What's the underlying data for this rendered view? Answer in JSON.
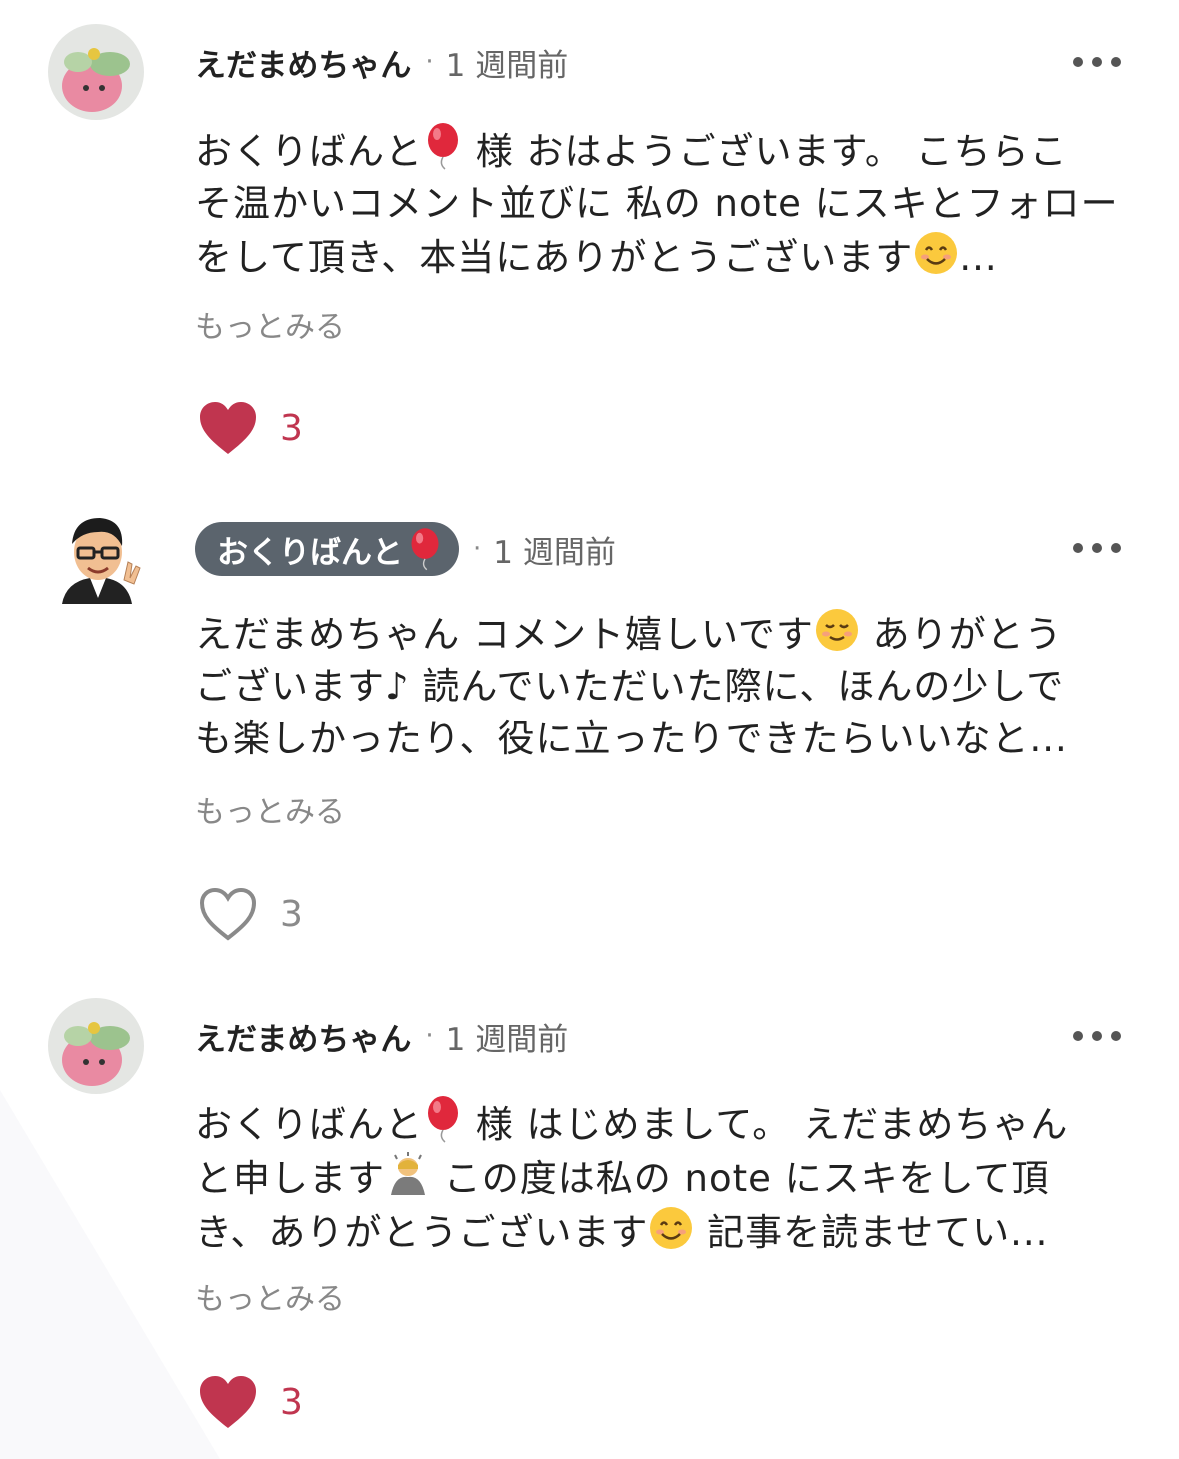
{
  "colors": {
    "like_active": "#c0354f",
    "like_inactive": "#8a8a8a",
    "badge_bg": "#5b646d"
  },
  "comments": [
    {
      "author": "えだまめちゃん",
      "time": "1 週間前",
      "lines": [
        "おくりばんと",
        "様 おはようございます。 こちらこ",
        "そ温かいコメント並びに 私の note にスキとフォロー",
        "をして頂き、本当にありがとうございます",
        "..."
      ],
      "see_more": "もっとみる",
      "like_count": "3",
      "liked": true,
      "avatar_icon": "edamame-avatar-icon"
    },
    {
      "author": "おくりばんと",
      "time": "1 週間前",
      "lines": [
        "えだまめちゃん コメント嬉しいです",
        " ありがとう",
        "ございます♪ 読んでいただいた際に、ほんの少しで",
        "も楽しかったり、役に立ったりできたらいいなと..."
      ],
      "see_more": "もっとみる",
      "like_count": "3",
      "liked": false,
      "avatar_icon": "okuribanto-avatar-icon"
    },
    {
      "author": "えだまめちゃん",
      "time": "1 週間前",
      "lines": [
        "おくりばんと",
        "様 はじめまして。 えだまめちゃん",
        "と申します",
        " この度は私の note にスキをして頂",
        "き、ありがとうございます",
        " 記事を読ませてい..."
      ],
      "see_more": "もっとみる",
      "like_count": "3",
      "liked": true,
      "avatar_icon": "edamame-avatar-icon"
    }
  ]
}
